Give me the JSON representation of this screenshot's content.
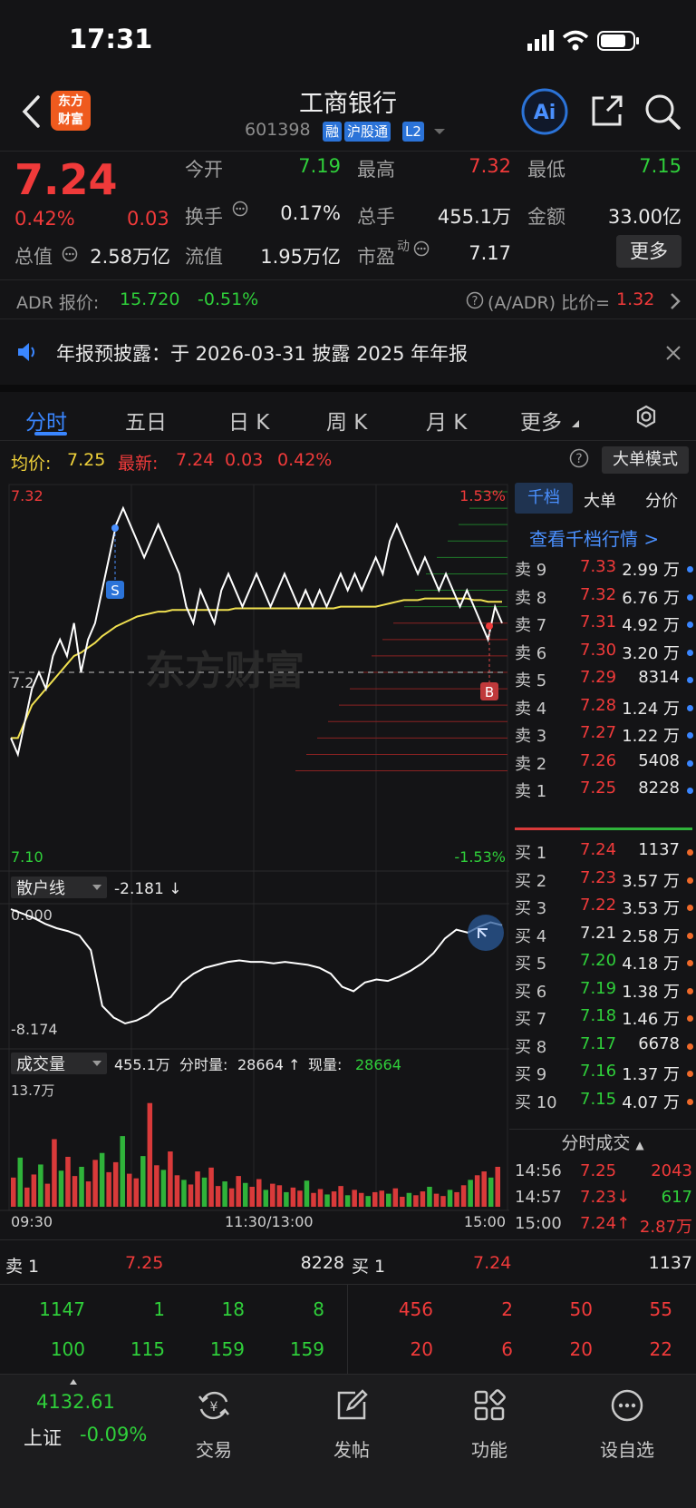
{
  "status_bar": {
    "time": "17:31"
  },
  "header": {
    "logo_text_1": "东方",
    "logo_text_2": "财富",
    "stock_name": "工商银行",
    "stock_code": "601398",
    "tags": [
      "融",
      "沪股通",
      "L2"
    ]
  },
  "quote": {
    "price": "7.24",
    "change_pct": "0.42%",
    "change": "0.03",
    "total_value_label": "总值",
    "total_value": "2.58万亿",
    "open_label": "今开",
    "open": "7.19",
    "turnover_label": "换手",
    "turnover": "0.17%",
    "float_label": "流值",
    "float_value": "1.95万亿",
    "high_label": "最高",
    "high": "7.32",
    "volume_label": "总手",
    "volume": "455.1万",
    "pe_label": "市盈",
    "pe_sup": "动",
    "pe": "7.17",
    "low_label": "最低",
    "low": "7.15",
    "amount_label": "金额",
    "amount": "33.00亿",
    "more_button": "更多"
  },
  "adr": {
    "label": "ADR 报价:",
    "price": "15.720",
    "change": "-0.51%",
    "ratio_label": "(A/ADR) 比价=",
    "ratio": "1.32"
  },
  "notice": {
    "text": "年报预披露：于 2026-03-31 披露 2025 年年报"
  },
  "tabs": [
    "分时",
    "五日",
    "日 K",
    "周 K",
    "月 K",
    "更多"
  ],
  "intraday": {
    "avg_label": "均价:",
    "avg": "7.25",
    "latest_label": "最新:",
    "latest": "7.24",
    "latest_change": "0.03",
    "latest_pct": "0.42%",
    "big_order_mode": "大单模式",
    "y_top": "7.32",
    "y_bottom": "7.10",
    "y_mid": "7.2",
    "pct_top": "1.53%",
    "pct_bottom": "-1.53%",
    "watermark": "东方财富",
    "marker_s": "S",
    "marker_b": "B"
  },
  "retail_line": {
    "label": "散户线",
    "value": "-2.181 ↓",
    "y_top": "0.000",
    "y_bottom": "-8.174"
  },
  "volume_panel": {
    "label": "成交量",
    "total": "455.1万",
    "minute_label": "分时量:",
    "minute": "28664 ↑",
    "current_label": "现量:",
    "current": "28664",
    "y_max": "13.7万",
    "time_start": "09:30",
    "time_mid": "11:30/13:00",
    "time_end": "15:00"
  },
  "book_tabs": [
    "千档",
    "大单",
    "分价"
  ],
  "book_link": "查看千档行情 >",
  "asks": [
    {
      "label": "卖 9",
      "price": "7.33",
      "vol": "2.99 万"
    },
    {
      "label": "卖 8",
      "price": "7.32",
      "vol": "6.76 万"
    },
    {
      "label": "卖 7",
      "price": "7.31",
      "vol": "4.92 万"
    },
    {
      "label": "卖 6",
      "price": "7.30",
      "vol": "3.20 万"
    },
    {
      "label": "卖 5",
      "price": "7.29",
      "vol": "8314"
    },
    {
      "label": "卖 4",
      "price": "7.28",
      "vol": "1.24 万"
    },
    {
      "label": "卖 3",
      "price": "7.27",
      "vol": "1.22 万"
    },
    {
      "label": "卖 2",
      "price": "7.26",
      "vol": "5408"
    },
    {
      "label": "卖 1",
      "price": "7.25",
      "vol": "8228"
    }
  ],
  "bids": [
    {
      "label": "买 1",
      "price": "7.24",
      "vol": "1137",
      "color": "red"
    },
    {
      "label": "买 2",
      "price": "7.23",
      "vol": "3.57 万",
      "color": "red"
    },
    {
      "label": "买 3",
      "price": "7.22",
      "vol": "3.53 万",
      "color": "red"
    },
    {
      "label": "买 4",
      "price": "7.21",
      "vol": "2.58 万",
      "color": "white"
    },
    {
      "label": "买 5",
      "price": "7.20",
      "vol": "4.18 万",
      "color": "green"
    },
    {
      "label": "买 6",
      "price": "7.19",
      "vol": "1.38 万",
      "color": "green"
    },
    {
      "label": "买 7",
      "price": "7.18",
      "vol": "1.46 万",
      "color": "green"
    },
    {
      "label": "买 8",
      "price": "7.17",
      "vol": "6678",
      "color": "green"
    },
    {
      "label": "买 9",
      "price": "7.16",
      "vol": "1.37 万",
      "color": "green"
    },
    {
      "label": "买 10",
      "price": "7.15",
      "vol": "4.07 万",
      "color": "green"
    }
  ],
  "trades_header": "分时成交",
  "trades": [
    {
      "time": "14:56",
      "price": "7.25",
      "vol": "2043",
      "pcolor": "red",
      "vcolor": "red"
    },
    {
      "time": "14:57",
      "price": "7.23↓",
      "vol": "617",
      "pcolor": "red",
      "vcolor": "green"
    },
    {
      "time": "15:00",
      "price": "7.24↑",
      "vol": "2.87万",
      "pcolor": "red",
      "vcolor": "red"
    }
  ],
  "bottom_quote": {
    "sell_label": "卖 1",
    "sell_price": "7.25",
    "sell_vol": "8228",
    "buy_label": "买 1",
    "buy_price": "7.24",
    "buy_vol": "1137",
    "sell_row1": [
      "1147",
      "1",
      "18",
      "8"
    ],
    "sell_row2": [
      "100",
      "115",
      "159",
      "159"
    ],
    "buy_row1": [
      "456",
      "2",
      "50",
      "55"
    ],
    "buy_row2": [
      "20",
      "6",
      "20",
      "22"
    ]
  },
  "tabbar": {
    "index_value": "4132.61",
    "index_name": "上证",
    "index_change": "-0.09%",
    "items": [
      "交易",
      "发帖",
      "功能",
      "设自选"
    ]
  },
  "colors": {
    "up": "#f03a3a",
    "down": "#2fcf3a",
    "accent": "#2b73d8",
    "avg_line": "#f0e050"
  },
  "chart_data": {
    "type": "line",
    "title": "",
    "ylim": [
      7.1,
      7.32
    ],
    "prev_close": 7.21,
    "series": [
      {
        "values": [
          7.17,
          7.16,
          7.18,
          7.2,
          7.21,
          7.2,
          7.22,
          7.23,
          7.22,
          7.24,
          7.21,
          7.23,
          7.24,
          7.26,
          7.28,
          7.3,
          7.31,
          7.3,
          7.29,
          7.28,
          7.29,
          7.3,
          7.29,
          7.28,
          7.27,
          7.25,
          7.24,
          7.26,
          7.25,
          7.24,
          7.26,
          7.27,
          7.26,
          7.25,
          7.26,
          7.27,
          7.26,
          7.25,
          7.26,
          7.27,
          7.26,
          7.25,
          7.26,
          7.25,
          7.26,
          7.25,
          7.26,
          7.27,
          7.26,
          7.27,
          7.26,
          7.27,
          7.28,
          7.27,
          7.29,
          7.3,
          7.29,
          7.28,
          7.27,
          7.28,
          7.27,
          7.26,
          7.27,
          7.26,
          7.25,
          7.26,
          7.25,
          7.24,
          7.23,
          7.25,
          7.24
        ]
      },
      {
        "values": [
          7.17,
          7.17,
          7.18,
          7.19,
          7.195,
          7.2,
          7.205,
          7.21,
          7.215,
          7.22,
          7.222,
          7.225,
          7.228,
          7.232,
          7.235,
          7.238,
          7.24,
          7.242,
          7.244,
          7.245,
          7.246,
          7.247,
          7.247,
          7.248,
          7.248,
          7.248,
          7.248,
          7.248,
          7.248,
          7.248,
          7.248,
          7.248,
          7.249,
          7.249,
          7.249,
          7.249,
          7.249,
          7.249,
          7.249,
          7.249,
          7.249,
          7.249,
          7.249,
          7.249,
          7.249,
          7.249,
          7.249,
          7.25,
          7.25,
          7.25,
          7.25,
          7.25,
          7.25,
          7.251,
          7.252,
          7.253,
          7.254,
          7.254,
          7.254,
          7.255,
          7.255,
          7.255,
          7.255,
          7.255,
          7.255,
          7.255,
          7.254,
          7.254,
          7.253,
          7.253,
          7.253
        ]
      }
    ],
    "retail_ylim": [
      -8.174,
      0.0
    ],
    "retail_values": [
      0.0,
      -0.3,
      -0.6,
      -1.0,
      -1.3,
      -1.5,
      -1.8,
      -2.8,
      -6.6,
      -7.4,
      -7.8,
      -7.6,
      -7.2,
      -6.5,
      -6.0,
      -5.0,
      -4.4,
      -4.0,
      -3.8,
      -3.6,
      -3.5,
      -3.6,
      -3.6,
      -3.7,
      -3.6,
      -3.7,
      -3.8,
      -4.0,
      -4.4,
      -5.3,
      -5.6,
      -5.0,
      -4.8,
      -4.9,
      -4.6,
      -4.2,
      -3.7,
      -3.0,
      -2.0,
      -1.4,
      -1.6,
      -1.2,
      -0.9,
      -1.1
    ],
    "volume_max": 137000,
    "volumes": [
      38,
      64,
      25,
      42,
      55,
      30,
      88,
      47,
      65,
      40,
      52,
      33,
      61,
      70,
      45,
      58,
      92,
      43,
      37,
      66,
      135,
      54,
      48,
      72,
      41,
      35,
      29,
      46,
      38,
      51,
      27,
      33,
      24,
      40,
      31,
      26,
      36,
      22,
      30,
      28,
      19,
      25,
      21,
      34,
      18,
      23,
      16,
      20,
      27,
      15,
      22,
      18,
      14,
      19,
      21,
      17,
      24,
      13,
      18,
      15,
      20,
      26,
      17,
      14,
      22,
      19,
      28,
      35,
      41,
      46,
      38,
      52
    ]
  }
}
